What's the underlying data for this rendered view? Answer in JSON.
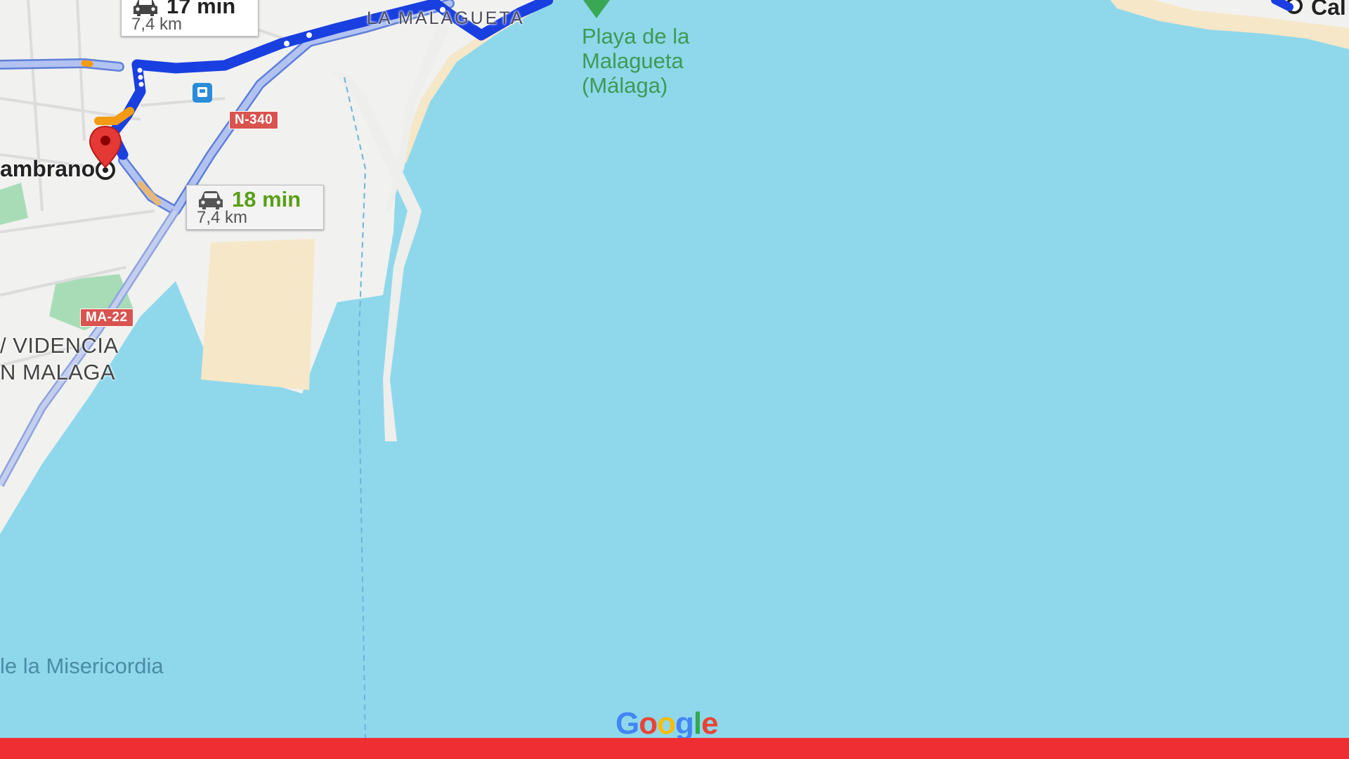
{
  "map": {
    "place_label": "Playa de la\nMalagueta\n(Málaga)",
    "place_label_lines": [
      "Playa de la",
      "Malagueta",
      "(Málaga)"
    ],
    "neighborhood": "LA MALAGUETA",
    "left_label_1": "ambrano",
    "left_label_2a": "/ VIDENCIA",
    "left_label_2b": "N MALAGA",
    "misericordia": "le la Misericordia",
    "top_right_label": "Cal",
    "road_n340": "N-340",
    "road_ma22": "MA-22",
    "logo": "Google",
    "colors": {
      "water": "#8fd8eb",
      "land": "#f1f1ef",
      "route_primary": "#1a3fe0",
      "route_alt": "#a9b9ee",
      "traffic": "#f29b13",
      "pin": "#e53935",
      "park": "#a8dcb7",
      "shield": "#d9534f",
      "bar": "#ee2e32"
    }
  },
  "routes": [
    {
      "time": "17 min",
      "distance": "7,4 km",
      "icon": "car-icon"
    },
    {
      "time": "18 min",
      "distance": "7,4 km",
      "icon": "car-icon"
    }
  ]
}
